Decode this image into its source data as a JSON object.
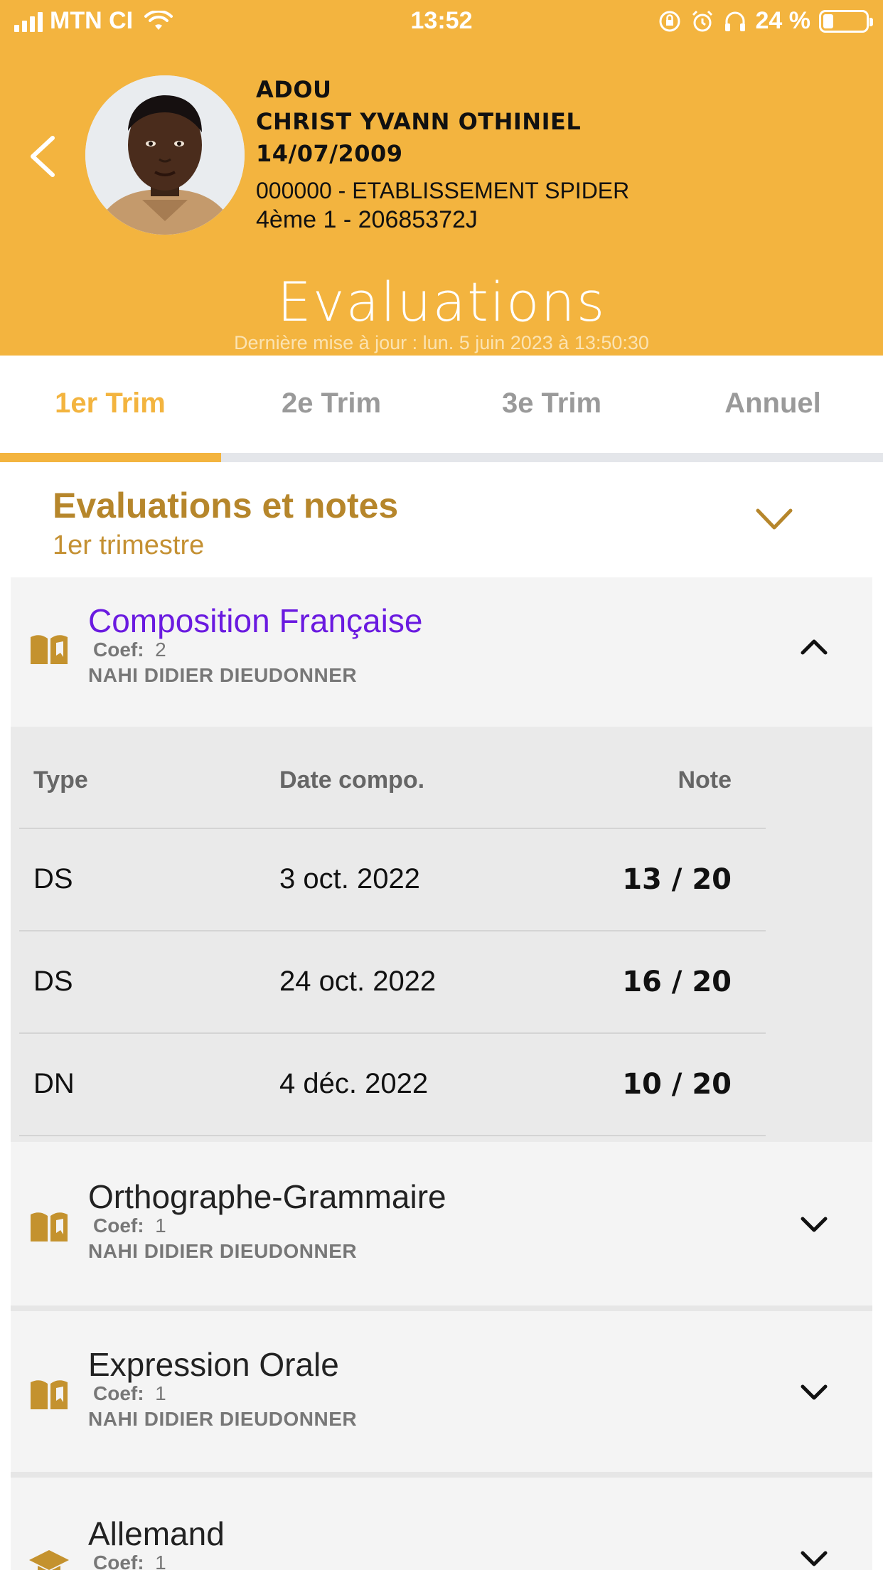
{
  "status_bar": {
    "carrier": "MTN CI",
    "time": "13:52",
    "battery_text": "24 %",
    "battery_level": 0.24
  },
  "profile": {
    "last_name": "ADOU",
    "first_names": "CHRIST YVANN OTHINIEL",
    "birth_date": "14/07/2009",
    "school": "000000 - ETABLISSEMENT SPIDER",
    "class_id": "4ème 1 - 20685372J"
  },
  "page": {
    "title": "Evaluations",
    "last_update": "Dernière mise à jour : lun. 5 juin 2023 à 13:50:30"
  },
  "tabs": [
    {
      "label": "1er Trim",
      "active": true
    },
    {
      "label": "2e Trim",
      "active": false
    },
    {
      "label": "3e Trim",
      "active": false
    },
    {
      "label": "Annuel",
      "active": false
    }
  ],
  "section": {
    "title": "Evaluations et notes",
    "subtitle": "1er trimestre"
  },
  "subjects": [
    {
      "name": "Composition Française",
      "coef_label": "Coef:",
      "coef": "2",
      "teacher": "NAHI DIDIER DIEUDONNER",
      "expanded": true,
      "icon": "book-icon"
    },
    {
      "name": "Orthographe-Grammaire",
      "coef_label": "Coef:",
      "coef": "1",
      "teacher": "NAHI DIDIER DIEUDONNER",
      "expanded": false,
      "icon": "book-icon"
    },
    {
      "name": "Expression Orale",
      "coef_label": "Coef:",
      "coef": "1",
      "teacher": "NAHI DIDIER DIEUDONNER",
      "expanded": false,
      "icon": "book-icon"
    },
    {
      "name": "Allemand",
      "coef_label": "Coef:",
      "coef": "1",
      "expanded": false,
      "icon": "graduation-cap-icon"
    }
  ],
  "grades": {
    "headers": {
      "type": "Type",
      "date": "Date compo.",
      "note": "Note"
    },
    "rows": [
      {
        "type": "DS",
        "date": "3 oct. 2022",
        "note": "13 / 20"
      },
      {
        "type": "DS",
        "date": "24 oct. 2022",
        "note": "16 / 20"
      },
      {
        "type": "DN",
        "date": "4 déc. 2022",
        "note": "10 / 20"
      }
    ]
  },
  "colors": {
    "header_bg": "#f3b43f",
    "accent_text": "#b6862b",
    "active_subject": "#6a1ae0"
  }
}
